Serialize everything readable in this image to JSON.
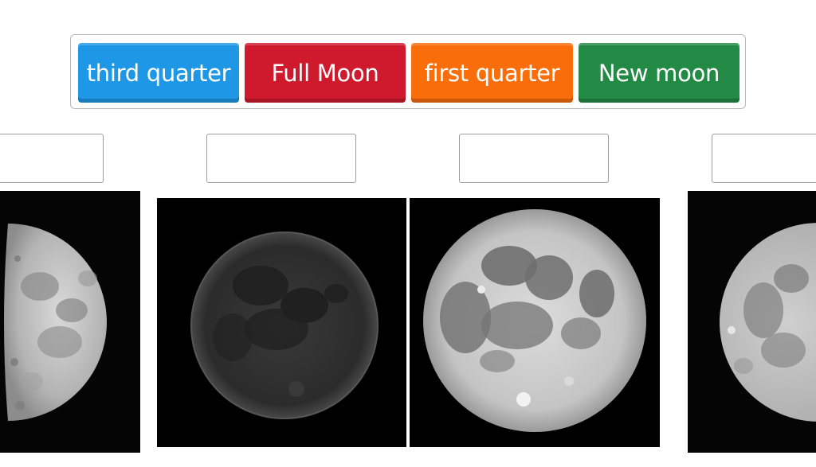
{
  "tiles": [
    {
      "label": "third quarter",
      "color": "#1e98e6"
    },
    {
      "label": "Full Moon",
      "color": "#cf1a2e"
    },
    {
      "label": "first quarter",
      "color": "#f96d0b"
    },
    {
      "label": "New moon",
      "color": "#238a45"
    }
  ],
  "drop_zones": [
    {
      "value": ""
    },
    {
      "value": ""
    },
    {
      "value": ""
    },
    {
      "value": ""
    }
  ],
  "images": [
    {
      "subject": "half-lit moon, lit on right"
    },
    {
      "subject": "dark faintly lit moon"
    },
    {
      "subject": "fully lit moon"
    },
    {
      "subject": "gibbous moon, cropped at right edge"
    }
  ]
}
